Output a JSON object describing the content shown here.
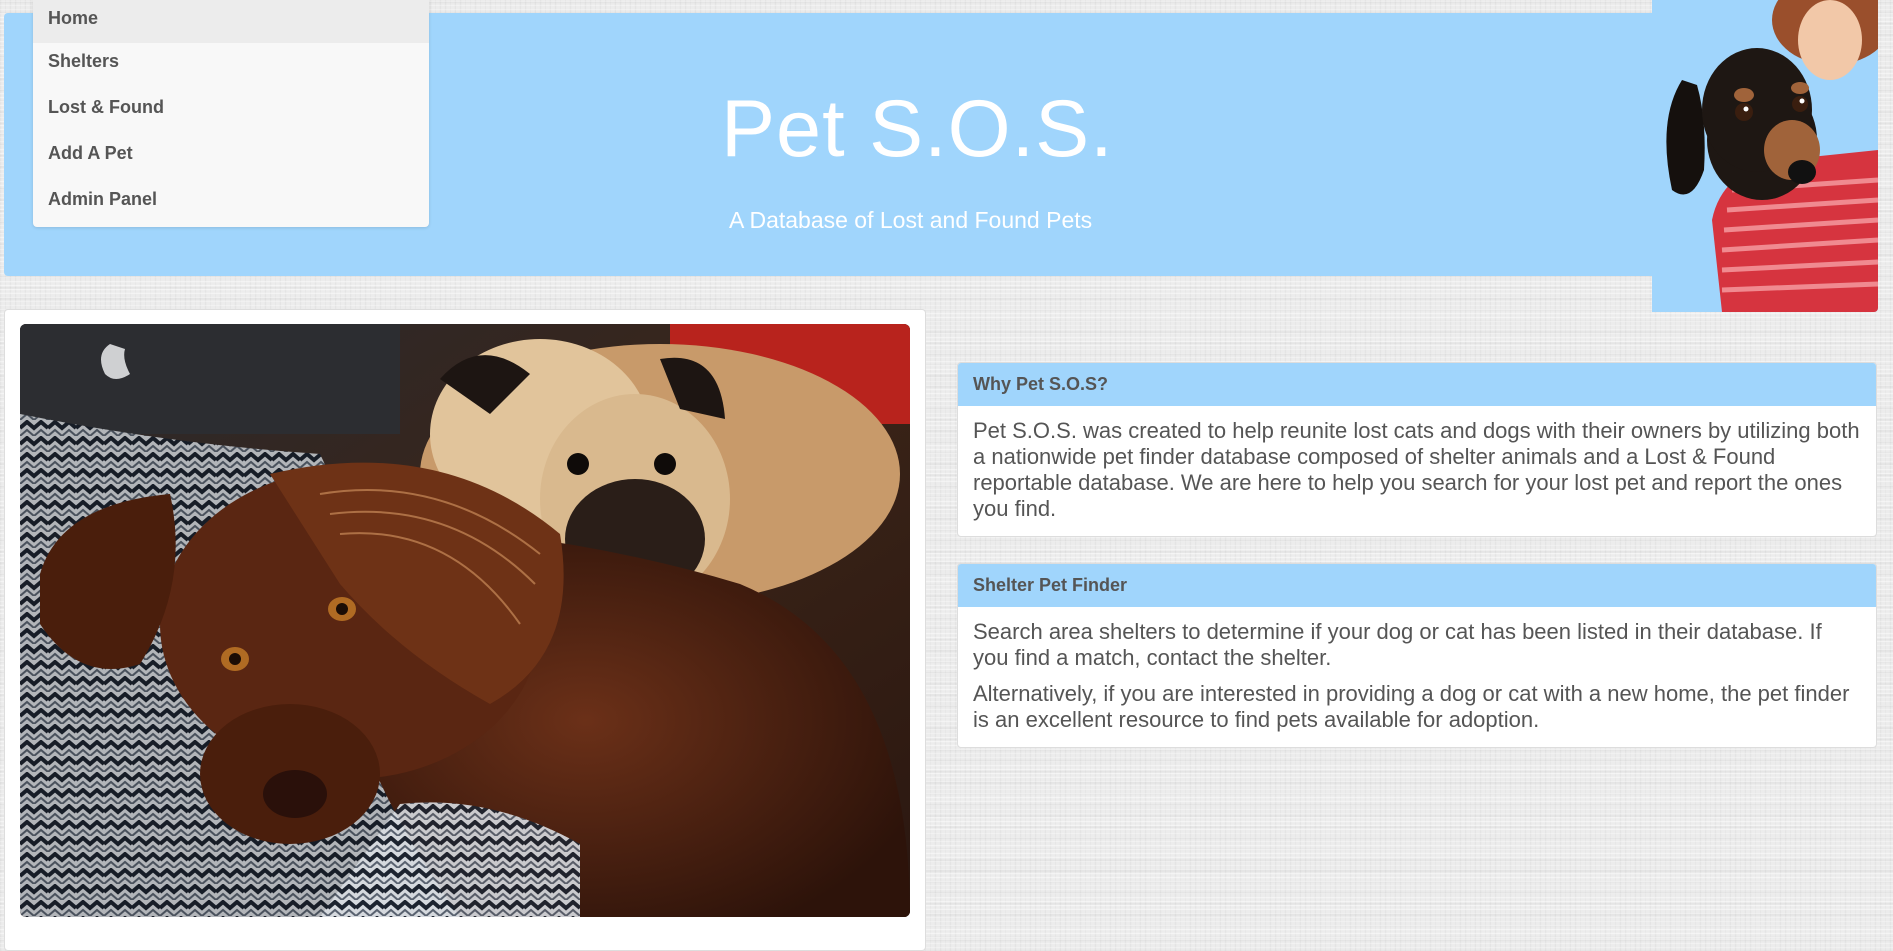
{
  "nav": {
    "items": [
      {
        "label": "Home",
        "active": true
      },
      {
        "label": "Shelters",
        "active": false
      },
      {
        "label": "Lost & Found",
        "active": false
      },
      {
        "label": "Add A Pet",
        "active": false
      },
      {
        "label": "Admin Panel",
        "active": false
      }
    ]
  },
  "header": {
    "title": "Pet S.O.S.",
    "subtitle": "A Database of Lost and Found Pets",
    "background_color": "#a0d5fc"
  },
  "panels": [
    {
      "heading": "Why Pet S.O.S?",
      "paragraphs": [
        "Pet S.O.S. was created to help reunite lost cats and dogs with their owners by utilizing both a nationwide pet finder database composed of shelter animals and a Lost & Found reportable database. We are here to help you search for your lost pet and report the ones you find."
      ]
    },
    {
      "heading": "Shelter Pet Finder",
      "paragraphs": [
        "Search area shelters to determine if your dog or cat has been listed in their database. If you find a match, contact the shelter.",
        "Alternatively, if you are interested in providing a dog or cat with a new home, the pet finder is an excellent resource to find pets available for adoption."
      ]
    }
  ]
}
